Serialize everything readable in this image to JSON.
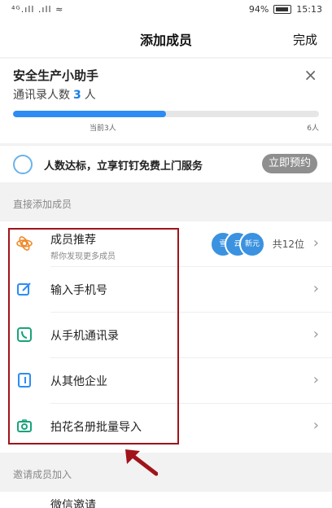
{
  "status_bar": {
    "left": "⁴ᴳ.ıll .ıll ≈",
    "battery": "94%",
    "time": "15:13"
  },
  "nav": {
    "title": "添加成员",
    "done": "完成"
  },
  "assistant": {
    "title": "安全生产小助手",
    "count_prefix": "通讯录人数",
    "count_value": "3",
    "count_suffix": "人",
    "progress_fraction": 0.5,
    "tick_current": "当前3人",
    "tick_max": "6人"
  },
  "promo": {
    "text": "人数达标，立享钉钉免费上门服务",
    "button": "立即预约"
  },
  "sections": {
    "direct": "直接添加成员",
    "invite": "邀请成员加入"
  },
  "rows": [
    {
      "label": "成员推荐",
      "sub": "帮你发现更多成员",
      "avatars": [
        "雪",
        "云",
        "新元"
      ],
      "meta": "共12位",
      "icon": "recommend-icon"
    },
    {
      "label": "输入手机号",
      "icon": "edit-icon"
    },
    {
      "label": "从手机通讯录",
      "icon": "phone-icon"
    },
    {
      "label": "从其他企业",
      "icon": "building-icon"
    },
    {
      "label": "拍花名册批量导入",
      "icon": "camera-icon"
    }
  ],
  "bottom_cut": "微信邀请",
  "colors": {
    "accent": "#2c8cf4",
    "highlight": "#a1131a"
  }
}
